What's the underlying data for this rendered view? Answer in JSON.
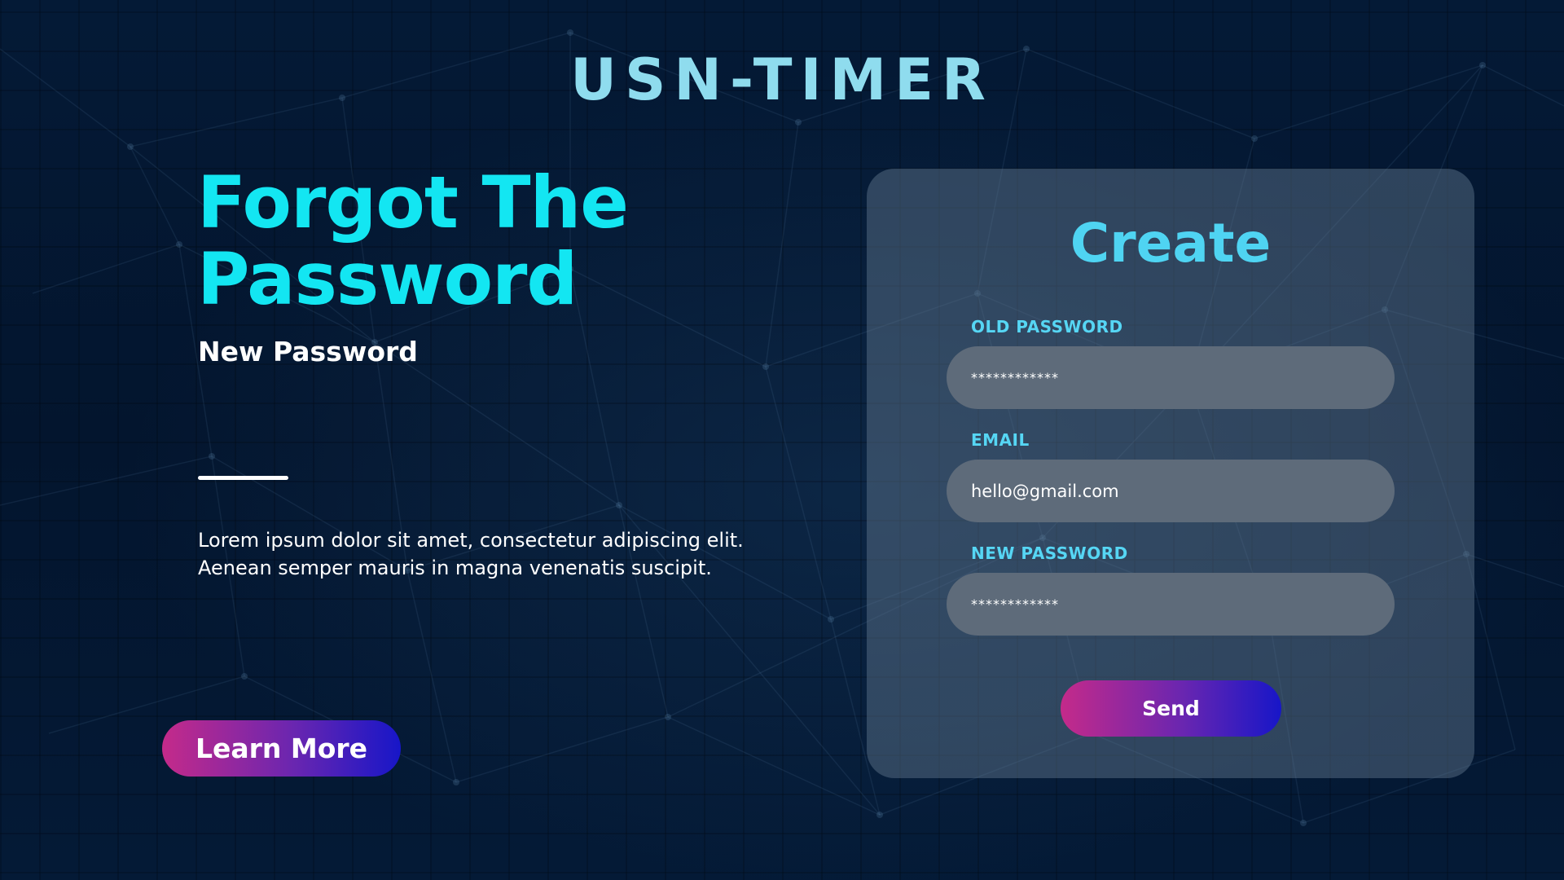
{
  "brand": {
    "logo_text": "USN-TIMER"
  },
  "hero": {
    "title_line1": "Forgot The",
    "title_line2": "Password",
    "subheading": "New Password",
    "body_line1": "Lorem ipsum dolor sit amet, consectetur adipiscing elit.",
    "body_line2": "Aenean semper mauris in magna venenatis suscipit.",
    "cta_label": "Learn More"
  },
  "form": {
    "title": "Create",
    "fields": [
      {
        "label": "OLD PASSWORD",
        "value": "************"
      },
      {
        "label": "EMAIL",
        "value": "hello@gmail.com"
      },
      {
        "label": "NEW PASSWORD",
        "value": "************"
      }
    ],
    "submit_label": "Send"
  },
  "colors": {
    "background": "#03152e",
    "brand": "#8fdcee",
    "headline": "#13e6f2",
    "accent": "#4fd4f2",
    "card": "#3d4c5e",
    "input": "#5e6b7a",
    "gradient_start": "#c42a8a",
    "gradient_end": "#1716c8"
  }
}
